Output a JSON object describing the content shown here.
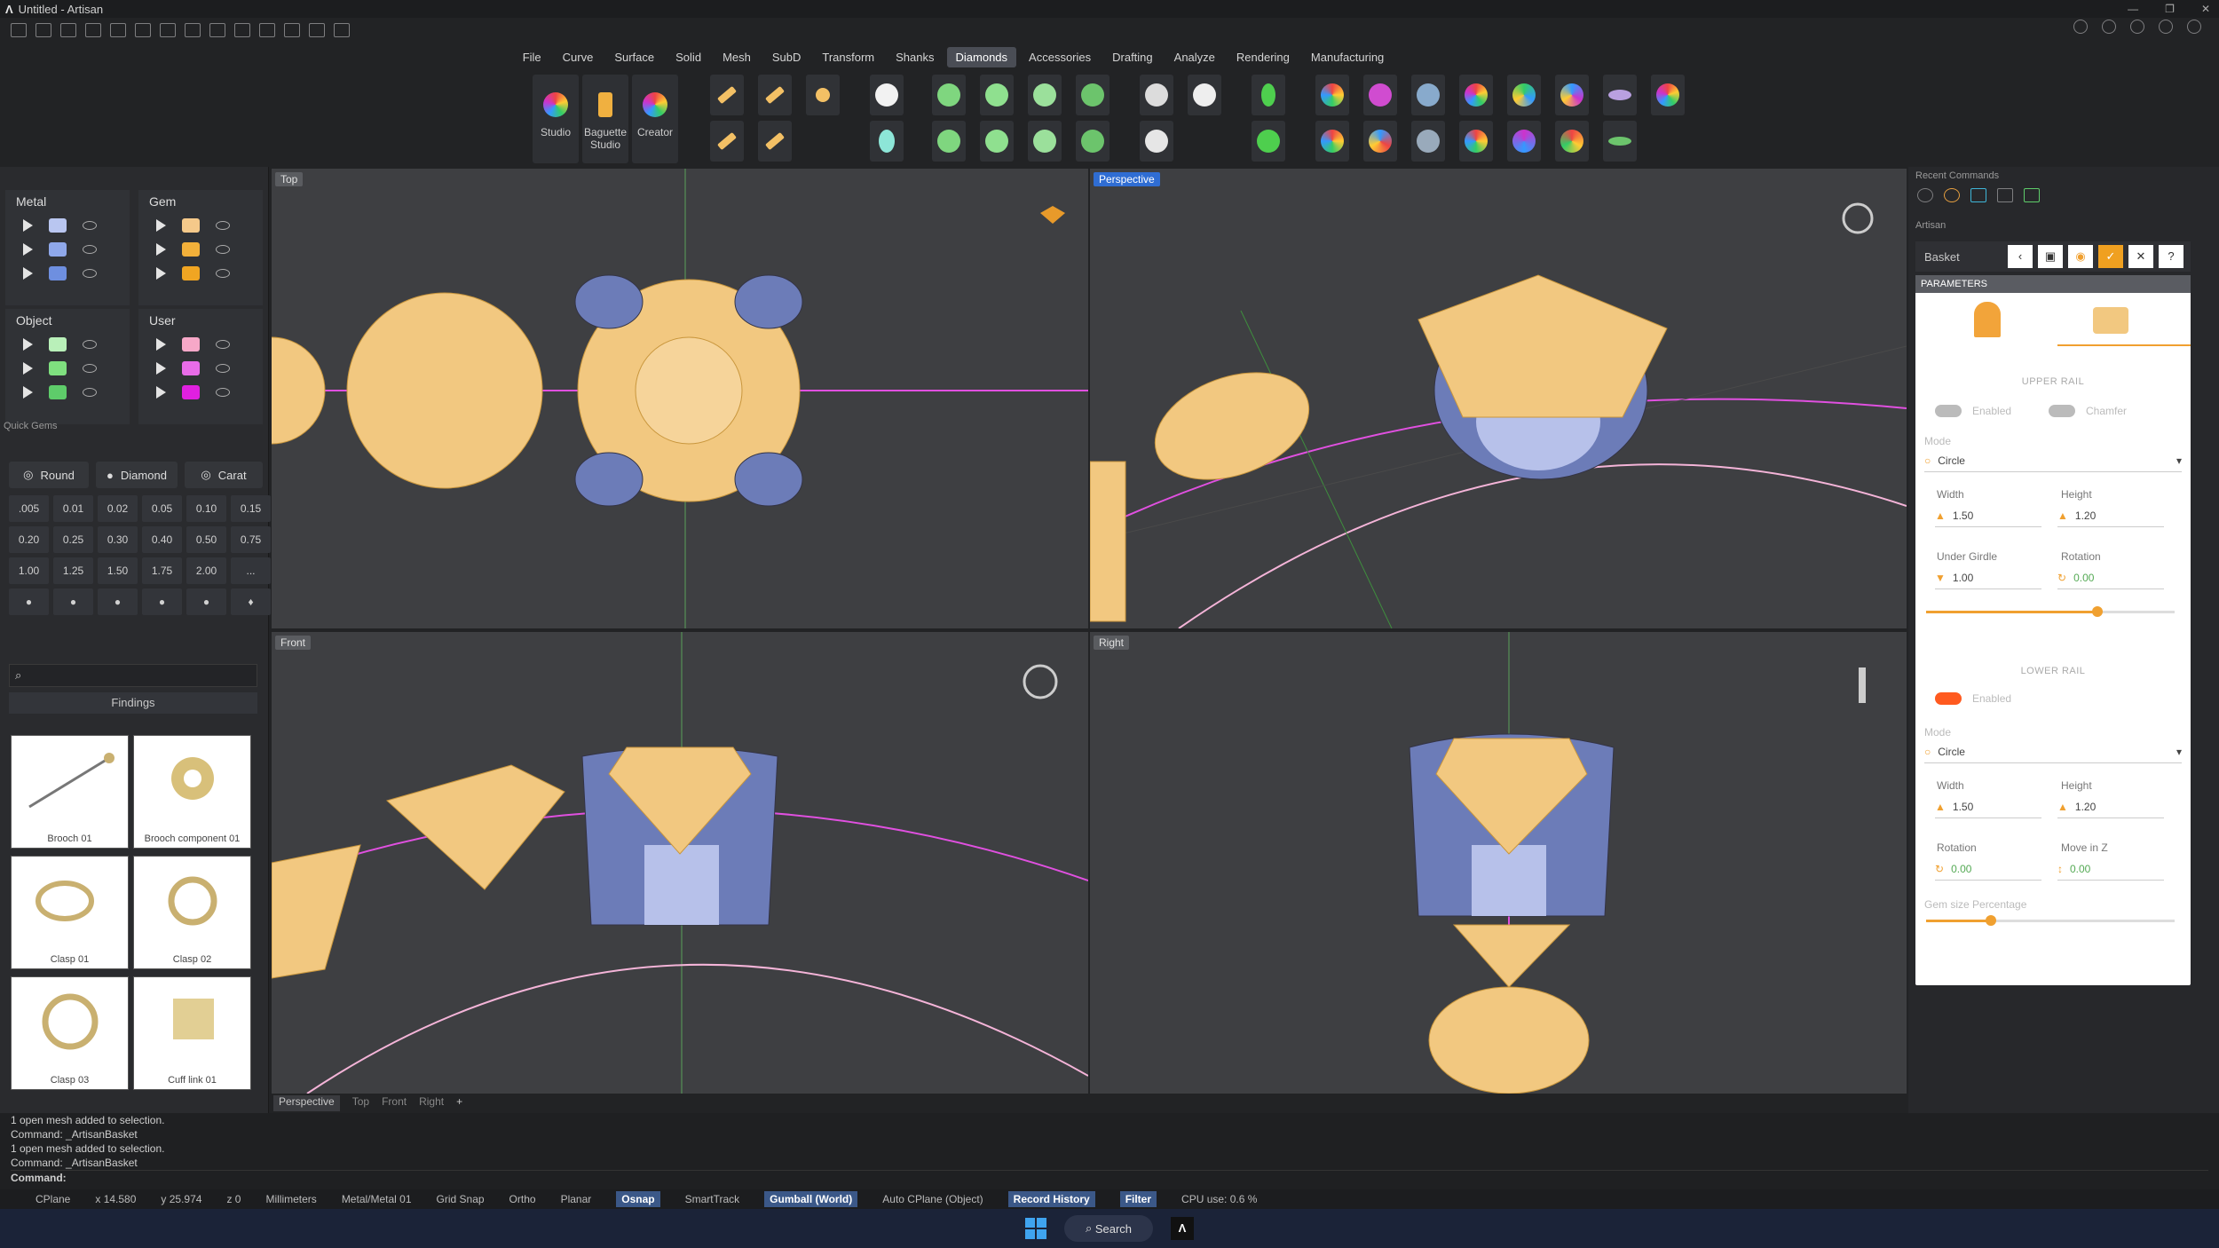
{
  "title_bar": {
    "app_title": "Untitled - Artisan"
  },
  "menu": {
    "items": [
      "File",
      "Curve",
      "Surface",
      "Solid",
      "Mesh",
      "SubD",
      "Transform",
      "Shanks",
      "Diamonds",
      "Accessories",
      "Drafting",
      "Analyze",
      "Rendering",
      "Manufacturing"
    ],
    "active": "Diamonds"
  },
  "ribbon": {
    "studio_label": "Studio",
    "baguette_label": "Baguette Studio",
    "creator_label": "Creator"
  },
  "layers": {
    "metal": {
      "label": "Metal",
      "swatches": [
        "#b9c6f0",
        "#8fa8ea",
        "#6e8fe0"
      ]
    },
    "gem": {
      "label": "Gem",
      "swatches": [
        "#f5c98a",
        "#f2b03a",
        "#f0a522"
      ]
    },
    "object": {
      "label": "Object",
      "swatches": [
        "#b9f0b9",
        "#7fe07f",
        "#5ecc6a"
      ]
    },
    "user": {
      "label": "User",
      "swatches": [
        "#f7a8c8",
        "#e86ce8",
        "#e020e0"
      ]
    }
  },
  "quick_gems": {
    "title": "Quick Gems",
    "modes": [
      "Round",
      "Diamond",
      "Carat"
    ],
    "sizes": [
      ".005",
      "0.01",
      "0.02",
      "0.05",
      "0.10",
      "0.15",
      "0.20",
      "0.25",
      "0.30",
      "0.40",
      "0.50",
      "0.75",
      "1.00",
      "1.25",
      "1.50",
      "1.75",
      "2.00",
      "..."
    ]
  },
  "library": {
    "section": "Findings",
    "items": [
      "Brooch 01",
      "Brooch component 01",
      "Clasp 01",
      "Clasp 02",
      "Clasp 03",
      "Cuff link 01"
    ]
  },
  "viewports": {
    "top": "Top",
    "perspective": "Perspective",
    "front": "Front",
    "right": "Right",
    "tabs": [
      "Perspective",
      "Top",
      "Front",
      "Right",
      "+"
    ]
  },
  "right_panel": {
    "recent_title": "Recent Commands",
    "artisan_title": "Artisan",
    "command_name": "Basket",
    "parameters_title": "PARAMETERS",
    "upper_rail": {
      "title": "UPPER RAIL",
      "enabled_label": "Enabled",
      "chamfer_label": "Chamfer",
      "mode_label": "Mode",
      "mode_value": "Circle",
      "width_label": "Width",
      "width_value": "1.50",
      "height_label": "Height",
      "height_value": "1.20",
      "under_girdle_label": "Under Girdle",
      "under_girdle_value": "1.00",
      "rotation_label": "Rotation",
      "rotation_value": "0.00"
    },
    "lower_rail": {
      "title": "LOWER RAIL",
      "enabled_label": "Enabled",
      "mode_label": "Mode",
      "mode_value": "Circle",
      "width_label": "Width",
      "width_value": "1.50",
      "height_label": "Height",
      "height_value": "1.20",
      "rotation_label": "Rotation",
      "rotation_value": "0.00",
      "move_z_label": "Move in Z",
      "move_z_value": "0.00"
    },
    "gem_size_label": "Gem size Percentage",
    "upper_slider_fraction": 0.69,
    "gem_size_fraction": 0.26,
    "accent": "#ff5a1f"
  },
  "command_history": [
    "1 open mesh added to selection.",
    "Command: _ArtisanBasket",
    "1 open mesh added to selection.",
    "Command: _ArtisanBasket"
  ],
  "command_prompt": "Command:",
  "status": {
    "cplane": "CPlane",
    "x": "x 14.580",
    "y": "y 25.974",
    "z": "z 0",
    "units": "Millimeters",
    "layer": "Metal/Metal 01",
    "grid_snap": "Grid Snap",
    "ortho": "Ortho",
    "planar": "Planar",
    "osnap": "Osnap",
    "smarttrack": "SmartTrack",
    "gumball": "Gumball (World)",
    "auto_cplane": "Auto CPlane (Object)",
    "record_history": "Record History",
    "filter": "Filter",
    "cpu": "CPU use: 0.6 %"
  },
  "taskbar": {
    "search": "Search"
  }
}
